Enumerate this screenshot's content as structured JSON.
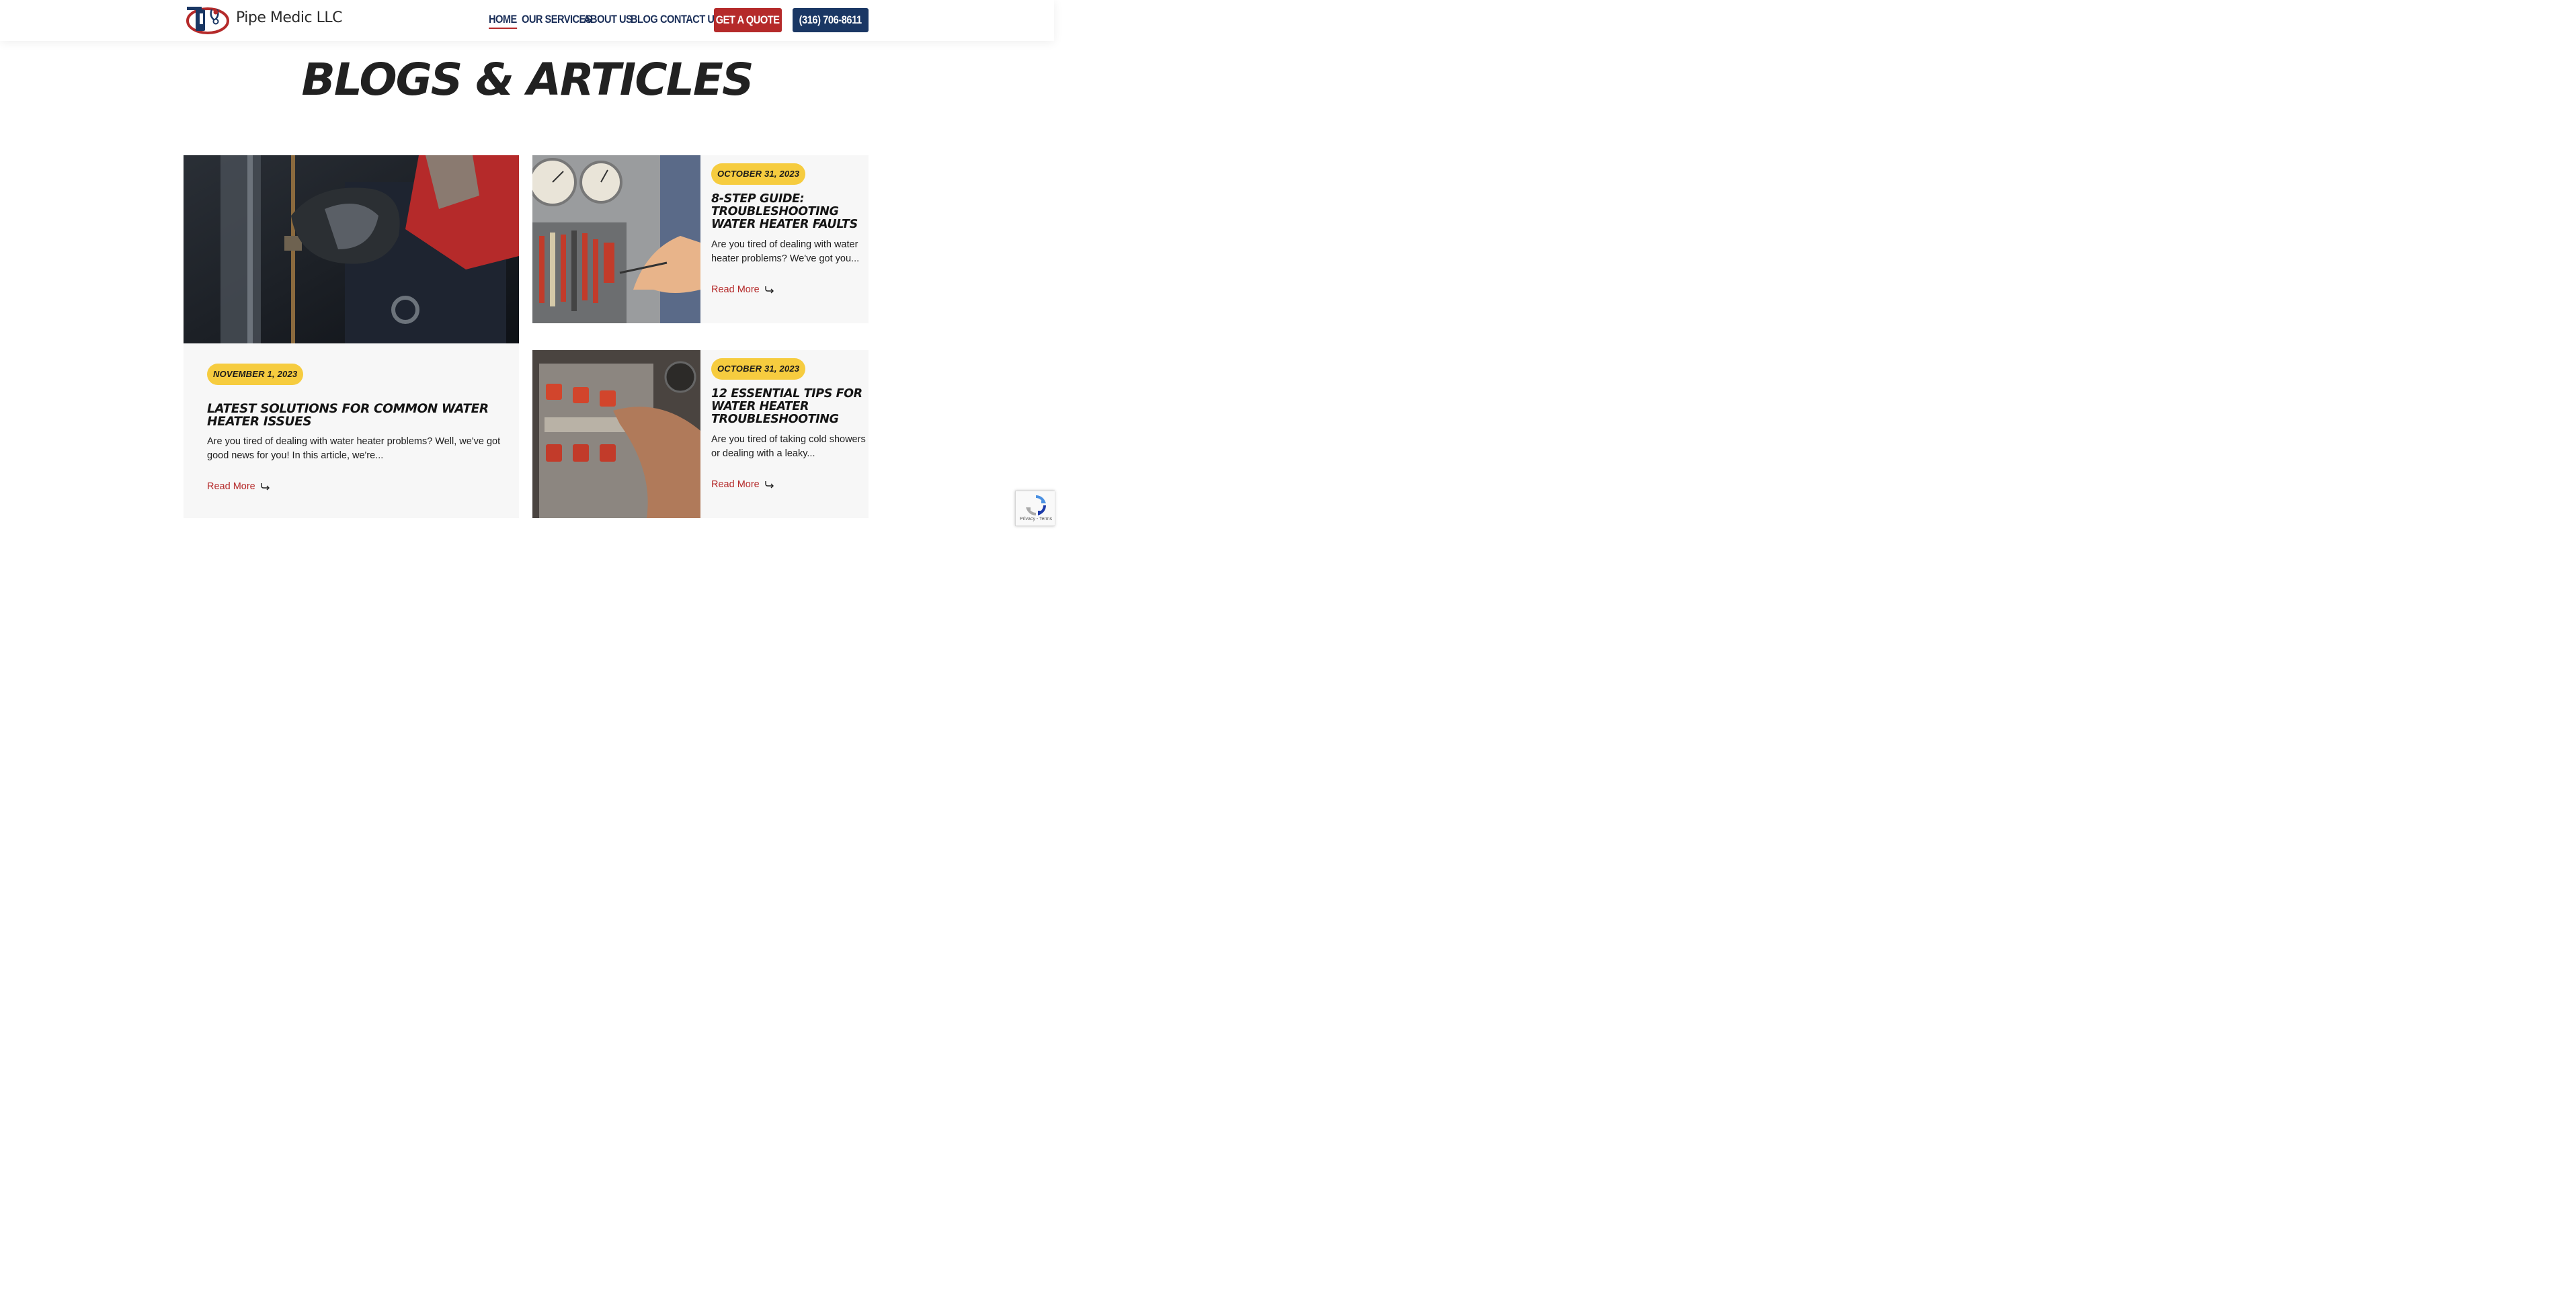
{
  "brand": {
    "name": "Pipe Medic LLC"
  },
  "nav": {
    "items": [
      {
        "label": "HOME",
        "active": true
      },
      {
        "label": "OUR SERVICES",
        "active": false
      },
      {
        "label": "ABOUT US",
        "active": false
      },
      {
        "label": "BLOG",
        "active": false
      },
      {
        "label": "CONTACT US",
        "active": false
      }
    ],
    "quote_label": "GET A QUOTE",
    "phone_label": "(316) 706-8611"
  },
  "page": {
    "title": "BLOGS & ARTICLES"
  },
  "posts": [
    {
      "date": "NOVEMBER 1, 2023",
      "title": "LATEST SOLUTIONS FOR COMMON WATER HEATER ISSUES",
      "excerpt": "Are you tired of dealing with water heater problems? Well, we've got good news for you! In this article, we're...",
      "read_more": "Read More"
    },
    {
      "date": "OCTOBER 31, 2023",
      "title": "8-STEP GUIDE: TROUBLESHOOTING WATER HEATER FAULTS",
      "excerpt": "Are you tired of dealing with water heater problems? We've got you...",
      "read_more": "Read More"
    },
    {
      "date": "OCTOBER 31, 2023",
      "title": "12 ESSENTIAL TIPS FOR WATER HEATER TROUBLESHOOTING",
      "excerpt": "Are you tired of taking cold showers or dealing with a leaky...",
      "read_more": "Read More"
    }
  ],
  "recaptcha": {
    "terms": "Privacy - Terms"
  },
  "colors": {
    "accent_red": "#b52a2a",
    "navy": "#1a3764",
    "badge_yellow": "#f6cc3f"
  }
}
